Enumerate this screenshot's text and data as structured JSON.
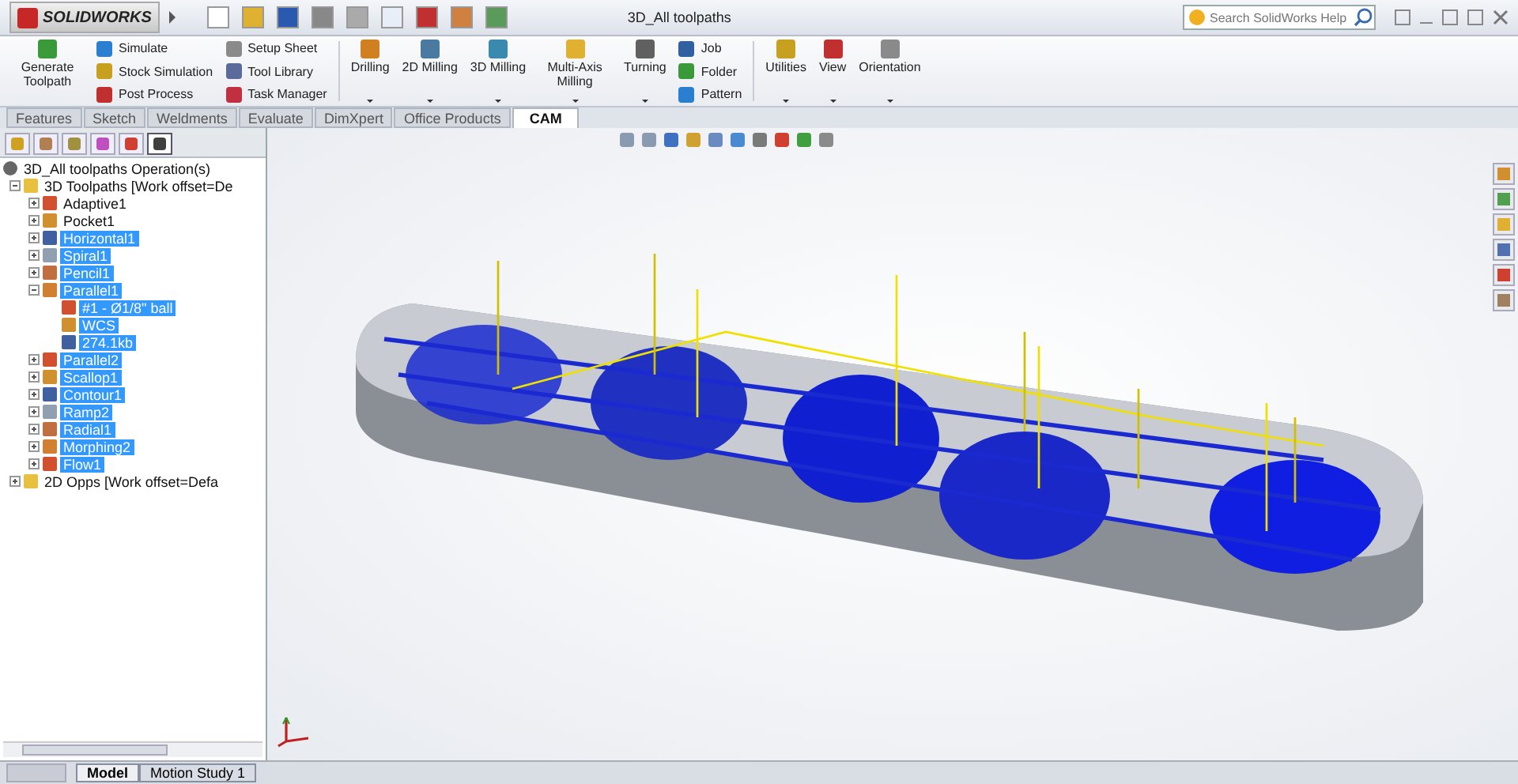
{
  "titlebar": {
    "logo": "SOLIDWORKS",
    "title": "3D_All toolpaths",
    "search": {
      "placeholder": "Search SolidWorks Help"
    }
  },
  "ribbon": [
    {
      "kind": "large",
      "label": "Generate Toolpath",
      "dropdown": false
    },
    {
      "kind": "stack",
      "items": [
        {
          "label": "Simulate"
        },
        {
          "label": "Stock Simulation"
        },
        {
          "label": "Post Process"
        }
      ]
    },
    {
      "kind": "stack",
      "items": [
        {
          "label": "Setup Sheet"
        },
        {
          "label": "Tool Library"
        },
        {
          "label": "Task Manager"
        }
      ]
    },
    {
      "kind": "sep"
    },
    {
      "kind": "large",
      "label": "Drilling",
      "dropdown": true
    },
    {
      "kind": "large",
      "label": "2D Milling",
      "dropdown": true
    },
    {
      "kind": "large",
      "label": "3D Milling",
      "dropdown": true
    },
    {
      "kind": "large",
      "label": "Multi-Axis Milling",
      "dropdown": true
    },
    {
      "kind": "large",
      "label": "Turning",
      "dropdown": true
    },
    {
      "kind": "stack",
      "items": [
        {
          "label": "Job"
        },
        {
          "label": "Folder"
        },
        {
          "label": "Pattern"
        }
      ]
    },
    {
      "kind": "sep"
    },
    {
      "kind": "large",
      "label": "Utilities",
      "dropdown": true
    },
    {
      "kind": "large",
      "label": "View",
      "dropdown": true
    },
    {
      "kind": "large",
      "label": "Orientation",
      "dropdown": true
    }
  ],
  "panel_tabs": [
    {
      "selected": false
    },
    {
      "selected": false
    },
    {
      "selected": false
    },
    {
      "selected": false
    },
    {
      "selected": false
    },
    {
      "selected": true
    }
  ],
  "tabs": [
    {
      "label": "Features",
      "selected": false
    },
    {
      "label": "Sketch",
      "selected": false
    },
    {
      "label": "Weldments",
      "selected": false
    },
    {
      "label": "Evaluate",
      "selected": false
    },
    {
      "label": "DimXpert",
      "selected": false
    },
    {
      "label": "Office Products",
      "selected": false
    },
    {
      "label": "CAM",
      "selected": true
    }
  ],
  "tree": {
    "root": "3D_All toolpaths Operation(s)",
    "items": [
      {
        "label": "3D Toolpaths [Work offset=De",
        "expanded": true,
        "selected": false,
        "children": [
          {
            "label": "Adaptive1",
            "expanded": false,
            "selected": false
          },
          {
            "label": "Pocket1",
            "expanded": false,
            "selected": false
          },
          {
            "label": "Horizontal1",
            "expanded": false,
            "selected": true
          },
          {
            "label": "Spiral1",
            "expanded": false,
            "selected": true
          },
          {
            "label": "Pencil1",
            "expanded": false,
            "selected": true
          },
          {
            "label": "Parallel1",
            "expanded": true,
            "selected": true,
            "children": [
              {
                "label": "#1 - Ø1/8\" ball",
                "selected": true
              },
              {
                "label": "WCS",
                "selected": true
              },
              {
                "label": "274.1kb",
                "selected": true
              }
            ]
          },
          {
            "label": "Parallel2",
            "expanded": false,
            "selected": true
          },
          {
            "label": "Scallop1",
            "expanded": false,
            "selected": true
          },
          {
            "label": "Contour1",
            "expanded": false,
            "selected": true
          },
          {
            "label": "Ramp2",
            "expanded": false,
            "selected": true
          },
          {
            "label": "Radial1",
            "expanded": false,
            "selected": true
          },
          {
            "label": "Morphing2",
            "expanded": false,
            "selected": true
          },
          {
            "label": "Flow1",
            "expanded": false,
            "selected": true
          }
        ]
      },
      {
        "label": "2D Opps [Work offset=Defa",
        "expanded": false,
        "selected": false
      }
    ]
  },
  "bottom_tabs": [
    {
      "label": "Model",
      "selected": true
    },
    {
      "label": "Motion Study 1",
      "selected": false
    }
  ]
}
